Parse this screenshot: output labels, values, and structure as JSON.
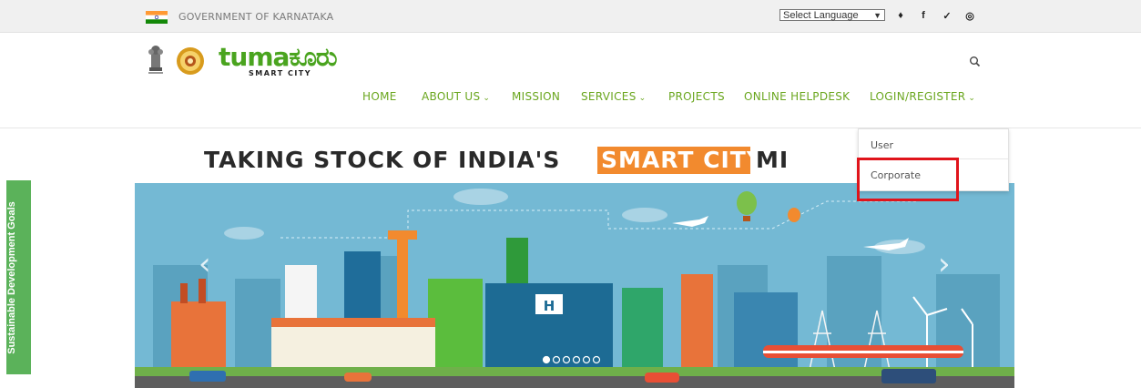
{
  "topbar": {
    "gov_label": "GOVERNMENT OF KARNATAKA",
    "language_select": "Select Language",
    "language_arrow": "▼",
    "social": [
      {
        "icon": "accessibility-icon",
        "glyph": "♦"
      },
      {
        "icon": "facebook-icon",
        "glyph": "f"
      },
      {
        "icon": "twitter-icon",
        "glyph": "✓"
      },
      {
        "icon": "instagram-icon",
        "glyph": "◎"
      }
    ]
  },
  "logo": {
    "brand_main": "tuma",
    "brand_kannada": "ಕೂರು",
    "brand_sub": "SMART CITY"
  },
  "nav": {
    "items": [
      {
        "label": "HOME",
        "chevron": ""
      },
      {
        "label": "ABOUT US",
        "chevron": "⌄"
      },
      {
        "label": "MISSION",
        "chevron": ""
      },
      {
        "label": "SERVICES",
        "chevron": "⌄"
      },
      {
        "label": "PROJECTS",
        "chevron": ""
      },
      {
        "label": "ONLINE HELPDESK",
        "chevron": ""
      },
      {
        "label": "LOGIN/REGISTER",
        "chevron": "⌄"
      }
    ]
  },
  "dropdown": {
    "items": [
      "User",
      "Corporate"
    ]
  },
  "banner": {
    "headline_left": "TAKING STOCK OF INDIA'S",
    "headline_highlight": "SMART CITY",
    "headline_right": "MI",
    "hospital_sign": "H",
    "prev_arrow": "‹",
    "next_arrow": "›"
  },
  "sidebar": {
    "sdg_label": "Sustainable Development Goals"
  },
  "colors": {
    "accent_green": "#6aa61e",
    "highlight_orange": "#f28a2e",
    "marker_red": "#e0141b",
    "sdg_green": "#5bb25a"
  }
}
